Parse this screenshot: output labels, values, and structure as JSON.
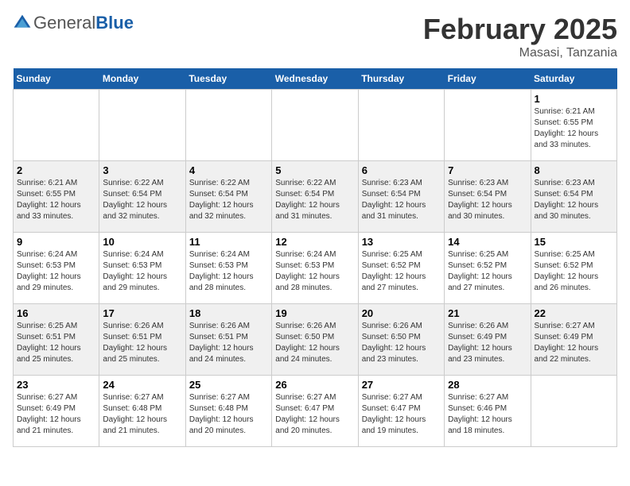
{
  "header": {
    "logo_general": "General",
    "logo_blue": "Blue",
    "month_year": "February 2025",
    "location": "Masasi, Tanzania"
  },
  "days_of_week": [
    "Sunday",
    "Monday",
    "Tuesday",
    "Wednesday",
    "Thursday",
    "Friday",
    "Saturday"
  ],
  "weeks": [
    [
      {
        "num": "",
        "info": ""
      },
      {
        "num": "",
        "info": ""
      },
      {
        "num": "",
        "info": ""
      },
      {
        "num": "",
        "info": ""
      },
      {
        "num": "",
        "info": ""
      },
      {
        "num": "",
        "info": ""
      },
      {
        "num": "1",
        "info": "Sunrise: 6:21 AM\nSunset: 6:55 PM\nDaylight: 12 hours and 33 minutes."
      }
    ],
    [
      {
        "num": "2",
        "info": "Sunrise: 6:21 AM\nSunset: 6:55 PM\nDaylight: 12 hours and 33 minutes."
      },
      {
        "num": "3",
        "info": "Sunrise: 6:22 AM\nSunset: 6:54 PM\nDaylight: 12 hours and 32 minutes."
      },
      {
        "num": "4",
        "info": "Sunrise: 6:22 AM\nSunset: 6:54 PM\nDaylight: 12 hours and 32 minutes."
      },
      {
        "num": "5",
        "info": "Sunrise: 6:22 AM\nSunset: 6:54 PM\nDaylight: 12 hours and 31 minutes."
      },
      {
        "num": "6",
        "info": "Sunrise: 6:23 AM\nSunset: 6:54 PM\nDaylight: 12 hours and 31 minutes."
      },
      {
        "num": "7",
        "info": "Sunrise: 6:23 AM\nSunset: 6:54 PM\nDaylight: 12 hours and 30 minutes."
      },
      {
        "num": "8",
        "info": "Sunrise: 6:23 AM\nSunset: 6:54 PM\nDaylight: 12 hours and 30 minutes."
      }
    ],
    [
      {
        "num": "9",
        "info": "Sunrise: 6:24 AM\nSunset: 6:53 PM\nDaylight: 12 hours and 29 minutes."
      },
      {
        "num": "10",
        "info": "Sunrise: 6:24 AM\nSunset: 6:53 PM\nDaylight: 12 hours and 29 minutes."
      },
      {
        "num": "11",
        "info": "Sunrise: 6:24 AM\nSunset: 6:53 PM\nDaylight: 12 hours and 28 minutes."
      },
      {
        "num": "12",
        "info": "Sunrise: 6:24 AM\nSunset: 6:53 PM\nDaylight: 12 hours and 28 minutes."
      },
      {
        "num": "13",
        "info": "Sunrise: 6:25 AM\nSunset: 6:52 PM\nDaylight: 12 hours and 27 minutes."
      },
      {
        "num": "14",
        "info": "Sunrise: 6:25 AM\nSunset: 6:52 PM\nDaylight: 12 hours and 27 minutes."
      },
      {
        "num": "15",
        "info": "Sunrise: 6:25 AM\nSunset: 6:52 PM\nDaylight: 12 hours and 26 minutes."
      }
    ],
    [
      {
        "num": "16",
        "info": "Sunrise: 6:25 AM\nSunset: 6:51 PM\nDaylight: 12 hours and 25 minutes."
      },
      {
        "num": "17",
        "info": "Sunrise: 6:26 AM\nSunset: 6:51 PM\nDaylight: 12 hours and 25 minutes."
      },
      {
        "num": "18",
        "info": "Sunrise: 6:26 AM\nSunset: 6:51 PM\nDaylight: 12 hours and 24 minutes."
      },
      {
        "num": "19",
        "info": "Sunrise: 6:26 AM\nSunset: 6:50 PM\nDaylight: 12 hours and 24 minutes."
      },
      {
        "num": "20",
        "info": "Sunrise: 6:26 AM\nSunset: 6:50 PM\nDaylight: 12 hours and 23 minutes."
      },
      {
        "num": "21",
        "info": "Sunrise: 6:26 AM\nSunset: 6:49 PM\nDaylight: 12 hours and 23 minutes."
      },
      {
        "num": "22",
        "info": "Sunrise: 6:27 AM\nSunset: 6:49 PM\nDaylight: 12 hours and 22 minutes."
      }
    ],
    [
      {
        "num": "23",
        "info": "Sunrise: 6:27 AM\nSunset: 6:49 PM\nDaylight: 12 hours and 21 minutes."
      },
      {
        "num": "24",
        "info": "Sunrise: 6:27 AM\nSunset: 6:48 PM\nDaylight: 12 hours and 21 minutes."
      },
      {
        "num": "25",
        "info": "Sunrise: 6:27 AM\nSunset: 6:48 PM\nDaylight: 12 hours and 20 minutes."
      },
      {
        "num": "26",
        "info": "Sunrise: 6:27 AM\nSunset: 6:47 PM\nDaylight: 12 hours and 20 minutes."
      },
      {
        "num": "27",
        "info": "Sunrise: 6:27 AM\nSunset: 6:47 PM\nDaylight: 12 hours and 19 minutes."
      },
      {
        "num": "28",
        "info": "Sunrise: 6:27 AM\nSunset: 6:46 PM\nDaylight: 12 hours and 18 minutes."
      },
      {
        "num": "",
        "info": ""
      }
    ]
  ]
}
